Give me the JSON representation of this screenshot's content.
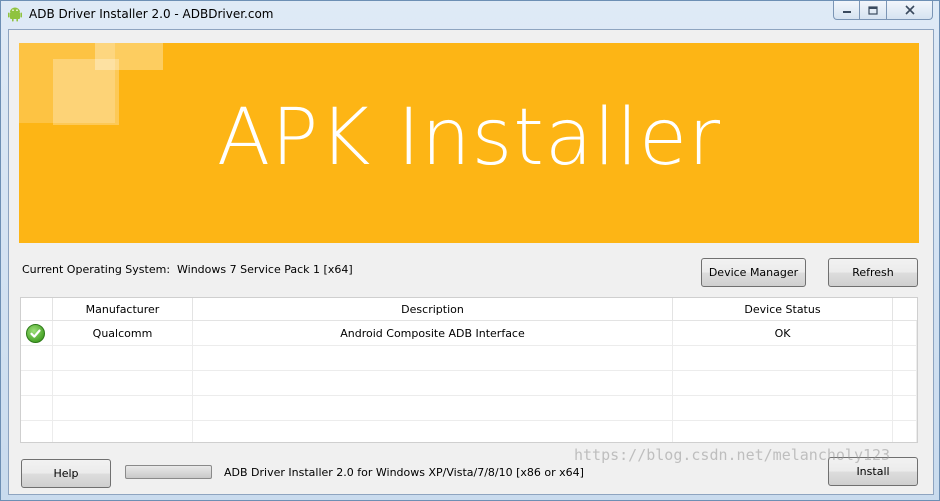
{
  "window": {
    "title": "ADB Driver Installer 2.0 - ADBDriver.com",
    "app_icon": "android-icon",
    "controls": {
      "minimize": "minimize-icon",
      "maximize": "maximize-icon",
      "close": "close-icon"
    }
  },
  "banner": {
    "title": "APK Installer",
    "color": "#fdb515"
  },
  "os": {
    "label": "Current Operating System:",
    "value": "Windows 7 Service Pack 1 [x64]"
  },
  "buttons": {
    "device_manager": "Device Manager",
    "refresh": "Refresh",
    "help": "Help",
    "install": "Install"
  },
  "table": {
    "columns": [
      "",
      "Manufacturer",
      "Description",
      "Device Status"
    ],
    "rows": [
      {
        "icon": "check-icon",
        "manufacturer": "Qualcomm",
        "description": "Android Composite ADB Interface",
        "status": "OK"
      }
    ]
  },
  "footer": {
    "progress": 0,
    "status": "ADB Driver Installer 2.0 for Windows XP/Vista/7/8/10 [x86 or x64]",
    "watermark": "https://blog.csdn.net/melancholy123"
  }
}
